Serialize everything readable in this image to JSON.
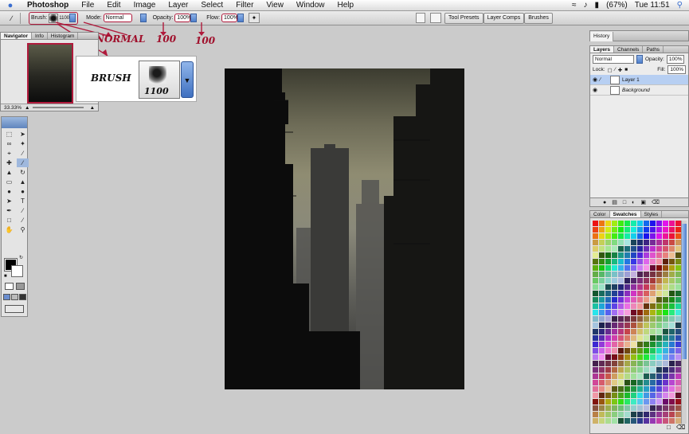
{
  "menubar": {
    "apple_icon": "apple-icon",
    "items": [
      "Photoshop",
      "File",
      "Edit",
      "Image",
      "Layer",
      "Select",
      "Filter",
      "View",
      "Window",
      "Help"
    ],
    "battery": "(67%)",
    "clock": "Tue 11:51"
  },
  "options_bar": {
    "brush_label": "Brush:",
    "brush_size": "1100",
    "mode_label": "Mode:",
    "mode_value": "Normal",
    "opacity_label": "Opacity:",
    "opacity_value": "100%",
    "flow_label": "Flow:",
    "flow_value": "100%",
    "wells": [
      "Tool Presets",
      "Layer Comps",
      "Brushes"
    ]
  },
  "annotations": {
    "mode": "NORMAL",
    "opacity": "100",
    "flow": "100",
    "brush": "BRUSH",
    "brush_size": "1100"
  },
  "navigator": {
    "tabs": [
      "Navigator",
      "Info",
      "Histogram"
    ],
    "zoom": "33.33%"
  },
  "right_panels": {
    "history_tab": "History",
    "layers_tabs": [
      "Layers",
      "Channels",
      "Paths"
    ],
    "blend_mode": "Normal",
    "opacity_label": "Opacity:",
    "opacity_value": "100%",
    "lock_label": "Lock:",
    "fill_label": "Fill:",
    "fill_value": "100%",
    "layers": [
      "Layer 1",
      "Background"
    ],
    "color_tabs": [
      "Color",
      "Swatches",
      "Styles"
    ]
  },
  "colors": {
    "highlight": "#b01a3c",
    "selection": "#b7cff2",
    "accent": "#4e7fcb"
  }
}
